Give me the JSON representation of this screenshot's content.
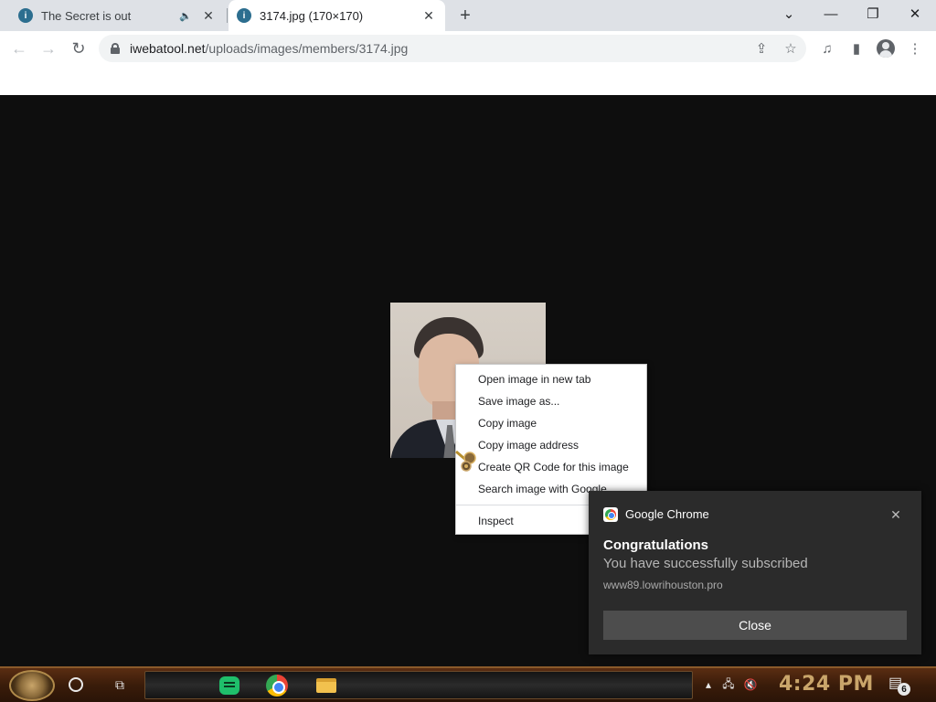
{
  "tabs": [
    {
      "title": "The Secret is out",
      "audio": "🔈",
      "close": "✕"
    },
    {
      "title": "3174.jpg (170×170)",
      "close": "✕"
    }
  ],
  "new_tab": "+",
  "window_controls": {
    "dropdown": "⌄",
    "minimize": "—",
    "restore": "❐",
    "close": "✕"
  },
  "toolbar": {
    "back": "←",
    "forward": "→",
    "reload": "↻",
    "share": "⇪",
    "bookmark_star": "☆",
    "media": "♫",
    "sidepanel": "▮",
    "menu": "⋮"
  },
  "address": {
    "domain": "iwebatool.net",
    "path": "/uploads/images/members/3174.jpg"
  },
  "context_menu": {
    "items": [
      "Open image in new tab",
      "Save image as...",
      "Copy image",
      "Copy image address",
      "Create QR Code for this image",
      "Search image with Google"
    ],
    "inspect": "Inspect"
  },
  "notification": {
    "app_name": "Google Chrome",
    "title": "Congratulations",
    "message": "You have successfully subscribed",
    "source": "www89.lowrihouston.pro",
    "button": "Close",
    "close_x": "✕"
  },
  "taskbar": {
    "clock": "4:24 PM",
    "notification_count": "6",
    "taskview_glyph": "⧉",
    "network_glyph": "🖧",
    "volume_glyph": "🔇",
    "notify_glyph": "▤"
  },
  "colors": {
    "accent_clock": "#c9a56a",
    "taskbar": "#3a1c0a",
    "toast_bg": "#2b2b2b"
  }
}
